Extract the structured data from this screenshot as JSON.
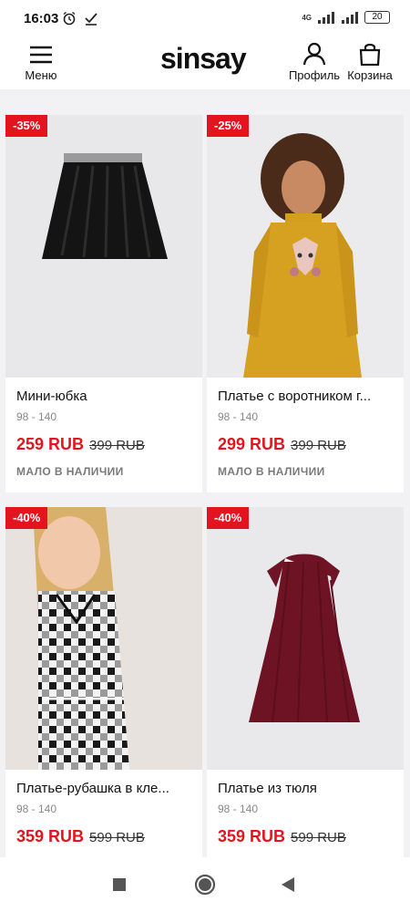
{
  "status": {
    "time": "16:03",
    "net": "4G",
    "battery": "20"
  },
  "header": {
    "menu_label": "Меню",
    "logo": "sinsay",
    "profile_label": "Профиль",
    "cart_label": "Корзина"
  },
  "products": [
    {
      "badge": "-35%",
      "name": "Мини-юбка",
      "sizes": "98 - 140",
      "price": "259 RUB",
      "old_price": "399 RUB",
      "stock": "МАЛО В НАЛИЧИИ"
    },
    {
      "badge": "-25%",
      "name": "Платье с воротником г...",
      "sizes": "98 - 140",
      "price": "299 RUB",
      "old_price": "399 RUB",
      "stock": "МАЛО В НАЛИЧИИ"
    },
    {
      "badge": "-40%",
      "name": "Платье-рубашка в кле...",
      "sizes": "98 - 140",
      "price": "359 RUB",
      "old_price": "599 RUB"
    },
    {
      "badge": "-40%",
      "name": "Платье из тюля",
      "sizes": "98 - 140",
      "price": "359 RUB",
      "old_price": "599 RUB"
    }
  ],
  "colors": {
    "accent": "#e4141e",
    "background": "#f2f2f4"
  },
  "icons": [
    "alarm-icon",
    "check-icon",
    "signal-icon",
    "battery-icon",
    "menu-icon",
    "user-icon",
    "bag-icon",
    "square-nav-icon",
    "circle-nav-icon",
    "back-nav-icon"
  ]
}
